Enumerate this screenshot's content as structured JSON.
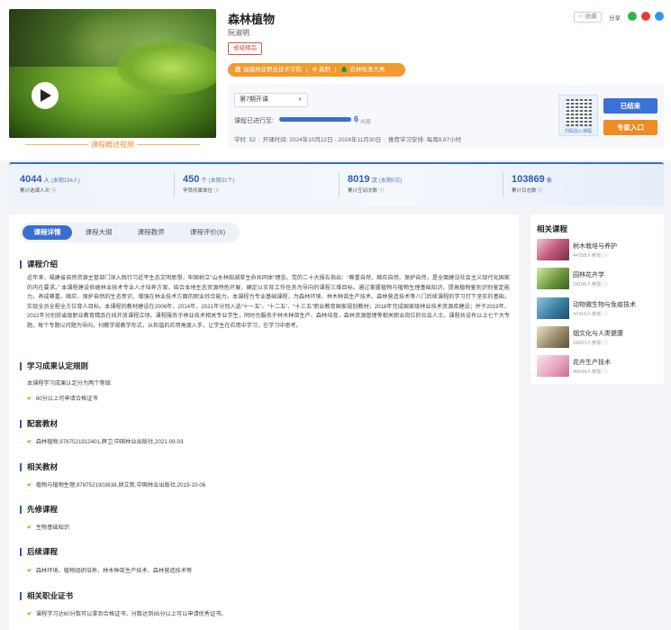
{
  "course": {
    "title": "森林植物",
    "teacher": "阮淑明",
    "level_badge": "省级精品",
    "org_items": [
      "🏛 福建林业职业技术学院",
      "|",
      "⚙ 高职",
      "|",
      "🌲 农林牧渔大类"
    ],
    "video_caption": "课程概述视频"
  },
  "actions": {
    "favorite_label": "☆ 收藏",
    "share_label": "分享",
    "share_icons": [
      "wechat-icon",
      "weibo-icon",
      "qq-icon"
    ],
    "share_colors": [
      "#2bb74a",
      "#e33b3b",
      "#2a9be8"
    ]
  },
  "session": {
    "semester": "第7期开课",
    "progress_label": "课程已进行至:",
    "progress_done": "6",
    "progress_total": "/6周",
    "progress_fraction": 1.0,
    "hours_label": "学时:",
    "hours_value": "52",
    "period": "开课时间: 2024年10月22日 - 2024年11月30日",
    "recommend": "推荐学习安排: 每周8.67小时",
    "qr_caption": "扫码加入课程",
    "ended_button": "已结束",
    "expert_button": "专家入口"
  },
  "stats": [
    {
      "num": "4044",
      "unit": "人",
      "sub": "(本期154人)",
      "desc": "累计选课人次 ⓘ"
    },
    {
      "num": "450",
      "unit": "个",
      "sub": "(本期31个)",
      "desc": "学员所属单位 ⓘ"
    },
    {
      "num": "8019",
      "unit": "次",
      "sub": "(本期0次)",
      "desc": "累计互动次数 ⓘ"
    },
    {
      "num": "103869",
      "unit": "条",
      "sub": "",
      "desc": "累计日志数 ⓘ"
    }
  ],
  "tabs": [
    "课程详情",
    "课程大纲",
    "课程教师",
    "课程评价(6)"
  ],
  "sections": {
    "intro_title": "课程介绍",
    "intro_text": "近年来，福建省自然资源主管部门深入践行习近平生态文明思想，牢固树立“山水林田湖草生命共同体”理念。党的二十大报告指出：“尊重自然、顺应自然、保护自然，是全面建设社会主义现代化国家的内在要求。” 本课程建设依据林业技术专业人才培养方案，结合本地生态资源特色开展，确定以实际工作任务为导向的课程三维目标。通过掌握植物与植物生理基础知识，提高植物鉴别识别鉴定能力，养成尊重、顺应、保护自然的生态意识，增强在林业技术方面的职业综合能力。本课程为专业基础课程，为森林环境、林木种苗生产技术、森林营造技术等八门后续课程的学习打下坚实的基础，实现全员全程全方位育人目标。本课程的教材建设在2006年、2014年、2021年分别入选“十一五”、“十二五”、“十三五”职业教育国家规划教材；2018年完成国家级林业技术资源库建设；并于2019年、2022年分别获省级职业教育精品在线开放课程立项。课程服务于林业技术相关专业学生，同时也服务于林木种苗生产、森林培育、森林资源管理等相关职业岗位的社会人士。课程共设有以上七个大专题，每个专题以问题为导向，扫教学规教学形式，从和谐的应用角度入手，让学生在应用中学习，在学习中思考。",
    "rule_title": "学习成果认定规则",
    "rule_text": "本课程学习成果认定分为两个等级:",
    "rule_items": [
      "60分以上可申请合格证书"
    ],
    "textbook_title": "配套教材",
    "textbook_items": [
      "森林植物,9787521912401,薛卫,中国林业出版社,2021-09-03"
    ],
    "related_title": "相关教材",
    "related_items": [
      "植物与植物生理,9787521903638,顾立新,中国林业出版社,2019-10-06"
    ],
    "prereq_title": "先修课程",
    "prereq_items": [
      "生物基础知识"
    ],
    "follow_title": "后续课程",
    "follow_items": [
      "森林环境、植物组织培养、林木种苗生产技术、森林营造技术等"
    ],
    "cert_title": "相关职业证书",
    "cert_items": [
      "课程学习达60分数可以拿到合格证书，分数达到85分以上可以申请优秀证书。"
    ]
  },
  "sidebar": {
    "title": "相关课程",
    "courses": [
      {
        "name": "树木栽培与养护",
        "learners": "44758人参加 ⓘ",
        "color": "#c25a7a"
      },
      {
        "name": "园林花卉学",
        "learners": "24196人参加 ⓘ",
        "color": "#6f9a3c"
      },
      {
        "name": "动物微生物与免疫技术",
        "learners": "47419人参加 ⓘ",
        "color": "#3c7fa3"
      },
      {
        "name": "烟文化与人类健康",
        "learners": "16603人参加 ⓘ",
        "color": "#9a8c6a"
      },
      {
        "name": "花卉生产技术",
        "learners": "45644人参加 ⓘ",
        "color": "#e9a6c2"
      }
    ]
  }
}
